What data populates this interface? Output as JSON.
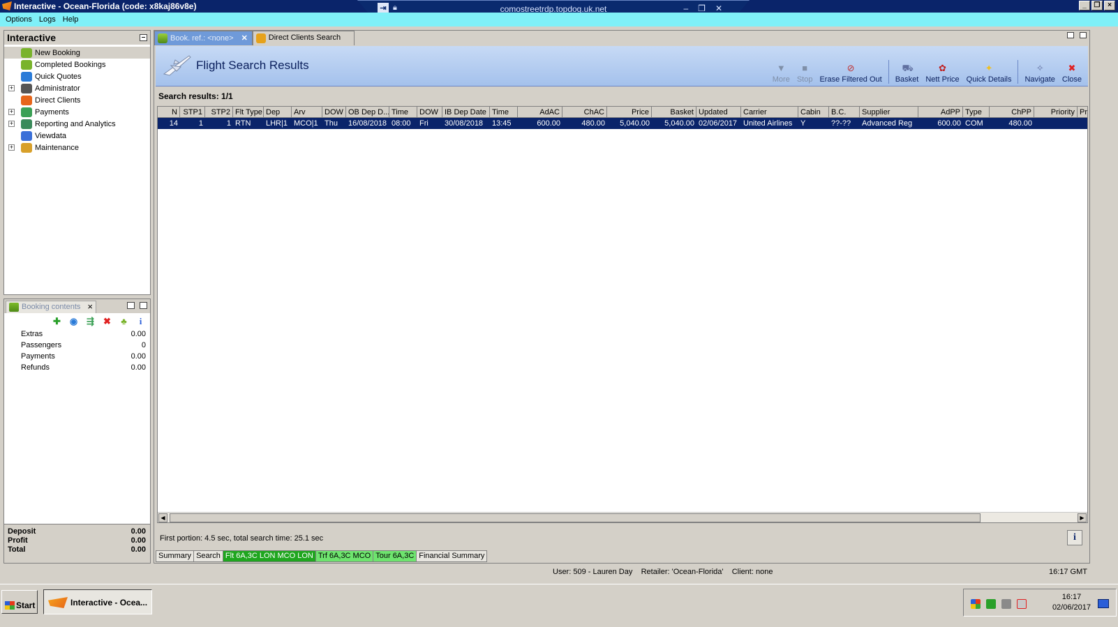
{
  "window": {
    "title": "Interactive - Ocean-Florida (code: x8kaj86v8e)",
    "rdp_host": "comostreetrdp.topdog.uk.net"
  },
  "menu": [
    "Options",
    "Logs",
    "Help"
  ],
  "nav": {
    "title": "Interactive",
    "items": [
      {
        "label": "New Booking",
        "expandable": false,
        "icon": "palm-tree-icon",
        "color": "#79b32b"
      },
      {
        "label": "Completed Bookings",
        "expandable": false,
        "icon": "palm-tree-icon",
        "color": "#79b32b"
      },
      {
        "label": "Quick Quotes",
        "expandable": false,
        "icon": "globe-clock-icon",
        "color": "#2a7bd8"
      },
      {
        "label": "Administrator",
        "expandable": true,
        "icon": "admin-person-icon",
        "color": "#555555"
      },
      {
        "label": "Direct Clients",
        "expandable": false,
        "icon": "user-star-icon",
        "color": "#e6651a"
      },
      {
        "label": "Payments",
        "expandable": true,
        "icon": "money-icon",
        "color": "#3aa055"
      },
      {
        "label": "Reporting and Analytics",
        "expandable": true,
        "icon": "report-icon",
        "color": "#3a8a5a"
      },
      {
        "label": "Viewdata",
        "expandable": false,
        "icon": "globe-icon",
        "color": "#3a6fd8"
      },
      {
        "label": "Maintenance",
        "expandable": true,
        "icon": "toolbox-icon",
        "color": "#d8a02a"
      }
    ]
  },
  "booking_contents": {
    "tab_label": "Booking contents",
    "rows": [
      {
        "label": "Extras",
        "value": "0.00"
      },
      {
        "label": "Passengers",
        "value": "0"
      },
      {
        "label": "Payments",
        "value": "0.00"
      },
      {
        "label": "Refunds",
        "value": "0.00"
      }
    ],
    "summary": [
      {
        "label": "Deposit",
        "value": "0.00"
      },
      {
        "label": "Profit",
        "value": "0.00"
      },
      {
        "label": "Total",
        "value": "0.00"
      }
    ]
  },
  "tabs": [
    {
      "label": "Book. ref.: <none>",
      "active": true
    },
    {
      "label": "Direct Clients Search",
      "active": false
    }
  ],
  "page": {
    "title": "Flight Search Results",
    "toolbar": [
      {
        "label": "More",
        "icon": "down-arrow-icon",
        "enabled": false
      },
      {
        "label": "Stop",
        "icon": "stop-icon",
        "enabled": false
      },
      {
        "label": "Erase Filtered Out",
        "icon": "erase-filter-icon",
        "enabled": true
      },
      {
        "label": "Basket",
        "icon": "basket-icon",
        "enabled": true
      },
      {
        "label": "Nett Price",
        "icon": "nett-price-icon",
        "enabled": true
      },
      {
        "label": "Quick Details",
        "icon": "lightbulb-icon",
        "enabled": true
      },
      {
        "label": "Navigate",
        "icon": "navigate-icon",
        "enabled": true
      },
      {
        "label": "Close",
        "icon": "close-icon",
        "enabled": true
      }
    ],
    "results_label": "Search results: 1/1"
  },
  "grid": {
    "columns": [
      "N",
      "STP1",
      "STP2",
      "Flt Type",
      "Dep",
      "Arv",
      "DOW",
      "OB Dep D...",
      "Time",
      "DOW",
      "IB Dep Date",
      "Time",
      "AdAC",
      "ChAC",
      "Price",
      "Basket",
      "Updated",
      "Carrier",
      "Cabin",
      "B.C.",
      "Supplier",
      "AdPP",
      "Type",
      "ChPP",
      "Priority",
      "Pr"
    ],
    "rows": [
      [
        "14",
        "1",
        "1",
        "RTN",
        "LHR|1",
        "MCO|1",
        "Thu",
        "16/08/2018",
        "08:00",
        "Fri",
        "30/08/2018",
        "13:45",
        "600.00",
        "480.00",
        "5,040.00",
        "5,040.00",
        "02/06/2017",
        "United Airlines",
        "Y",
        "??-??",
        "Advanced Reg",
        "600.00",
        "COM",
        "480.00",
        "",
        ""
      ]
    ]
  },
  "footer": {
    "portion": "First portion: 4.5 sec, total search time: 25.1 sec",
    "bottom_tabs": [
      "Summary",
      "Search",
      "Flt 6A,3C LON MCO LON",
      "Trf 6A,3C MCO",
      "Tour 6A,3C",
      "Financial Summary"
    ]
  },
  "status": {
    "user": "User: 509 - Lauren Day",
    "retailer": "Retailer: 'Ocean-Florida'",
    "client": "Client: none",
    "time": "16:17 GMT"
  },
  "taskbar": {
    "start": "Start",
    "item": "Interactive - Ocea...",
    "clock_time": "16:17",
    "clock_date": "02/06/2017"
  }
}
